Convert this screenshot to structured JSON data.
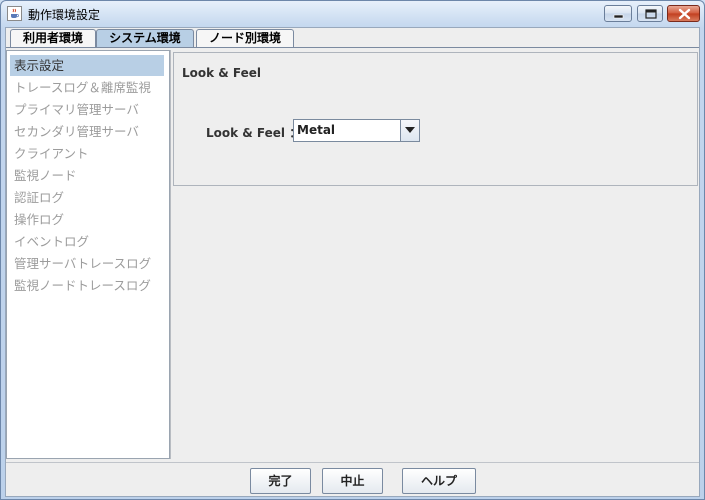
{
  "window": {
    "title": "動作環境設定"
  },
  "tabs": [
    {
      "label": "利用者環境"
    },
    {
      "label": "システム環境"
    },
    {
      "label": "ノード別環境"
    }
  ],
  "nav": {
    "items": [
      {
        "label": "表示設定"
      },
      {
        "label": "トレースログ＆離席監視"
      },
      {
        "label": "プライマリ管理サーバ"
      },
      {
        "label": "セカンダリ管理サーバ"
      },
      {
        "label": "クライアント"
      },
      {
        "label": "監視ノード"
      },
      {
        "label": "認証ログ"
      },
      {
        "label": "操作ログ"
      },
      {
        "label": "イベントログ"
      },
      {
        "label": "管理サーバトレースログ"
      },
      {
        "label": "監視ノードトレースログ"
      }
    ]
  },
  "panel": {
    "group_title": "Look & Feel",
    "field_label": "Look & Feel ：",
    "combo_value": "Metal"
  },
  "buttons": {
    "done": "完了",
    "cancel": "中止",
    "help": "ヘルプ"
  },
  "icons": {
    "app": "java-cup-icon",
    "minimize": "minimize-icon",
    "maximize": "maximize-icon",
    "close": "close-icon",
    "dropdown": "chevron-down-icon"
  },
  "colors": {
    "selection": "#b8cfe5",
    "close_button": "#c13e1f"
  }
}
